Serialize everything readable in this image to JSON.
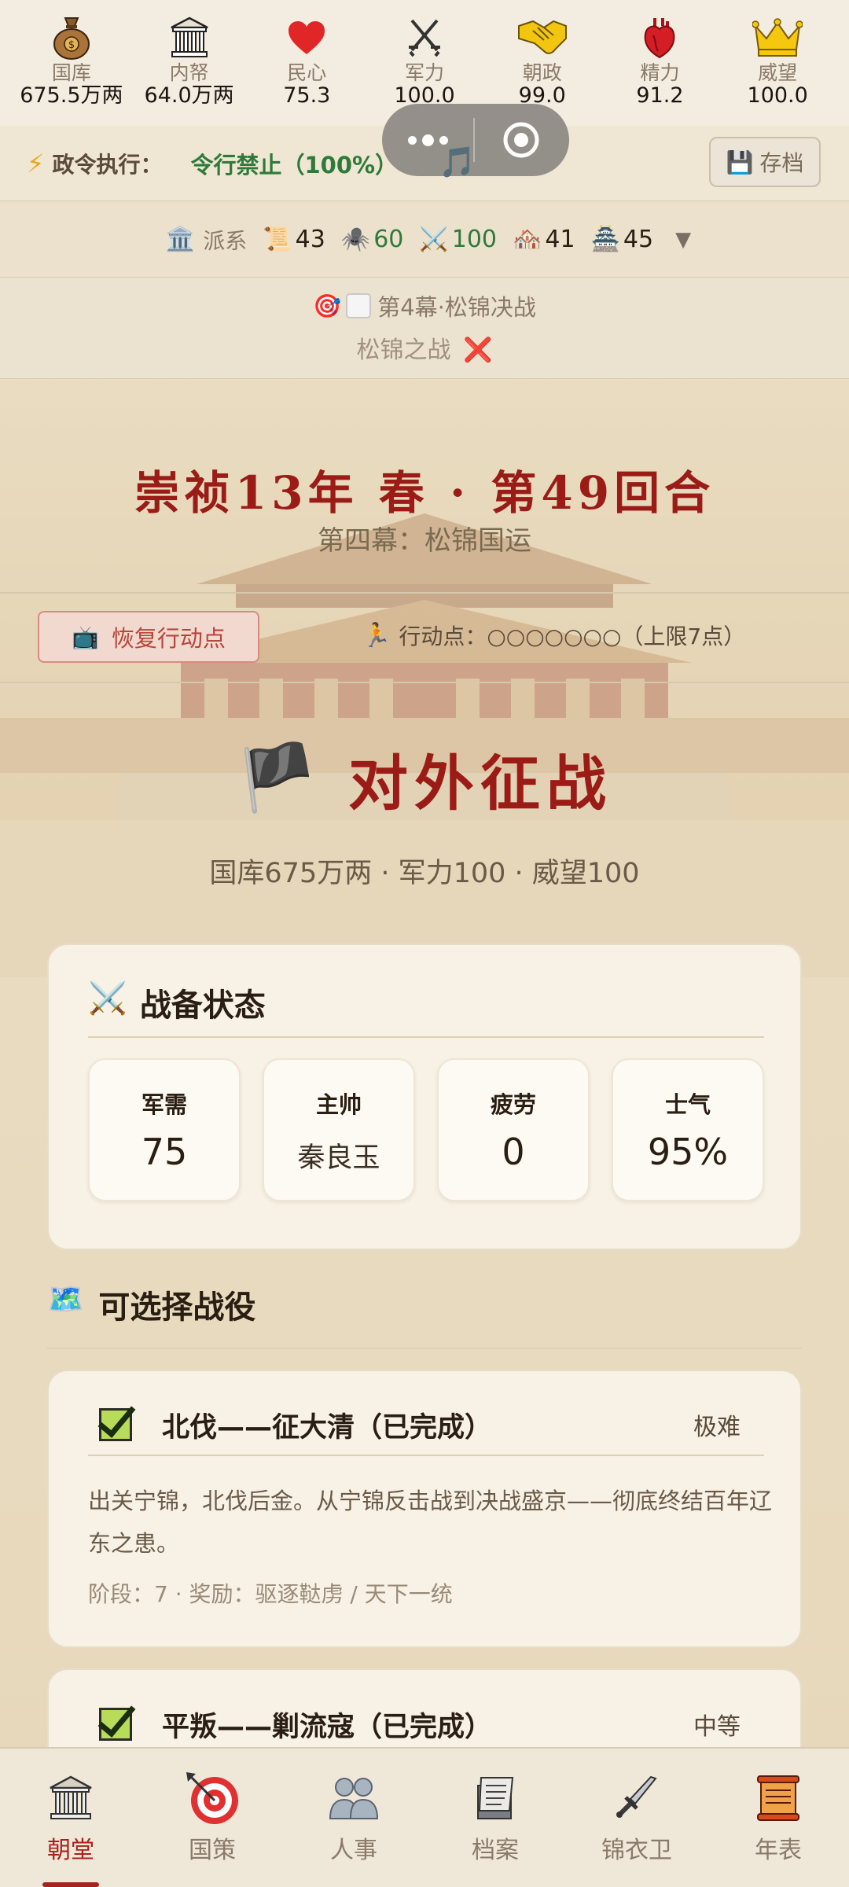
{
  "stats": [
    {
      "icon": "money-bag-icon",
      "label": "国库",
      "value": "675.5万两"
    },
    {
      "icon": "treasury-building-icon",
      "label": "内帑",
      "value": "64.0万两"
    },
    {
      "icon": "heart-icon",
      "label": "民心",
      "value": "75.3"
    },
    {
      "icon": "crossed-swords-icon",
      "label": "军力",
      "value": "100.0"
    },
    {
      "icon": "handshake-icon",
      "label": "朝政",
      "value": "99.0"
    },
    {
      "icon": "anatomical-heart-icon",
      "label": "精力",
      "value": "91.2"
    },
    {
      "icon": "crown-icon",
      "label": "威望",
      "value": "100.0"
    }
  ],
  "decree": {
    "label": "政令执行：",
    "value": "令行禁止（100%）",
    "save_label": "存档"
  },
  "factions": {
    "title": "派系",
    "items": [
      {
        "emoji": "📜",
        "value": "43",
        "color": "#2a1e12"
      },
      {
        "emoji": "🕷️",
        "value": "60",
        "color": "#2f7a3a"
      },
      {
        "emoji": "⚔️",
        "value": "100",
        "color": "#2f7a3a"
      },
      {
        "emoji": "🏘️",
        "value": "41",
        "color": "#2a1e12"
      },
      {
        "emoji": "🏯",
        "value": "45",
        "color": "#2a1e12"
      }
    ]
  },
  "act": {
    "objective": "第4幕·松锦决战",
    "battle": "松锦之战",
    "battle_status": "❌"
  },
  "turn": {
    "title": "崇祯13年 春 · 第49回合",
    "subtitle": "第四幕：松锦国运"
  },
  "actions": {
    "restore_label": "恢复行动点",
    "points_text": "行动点：○○○○○○○（上限7点）"
  },
  "expedition": {
    "title": "对外征战",
    "summary": "国库675万两 · 军力100 · 威望100"
  },
  "readiness": {
    "title": "战备状态",
    "tiles": [
      {
        "label": "军需",
        "value": "75"
      },
      {
        "label": "主帅",
        "value": "秦良玉"
      },
      {
        "label": "疲劳",
        "value": "0"
      },
      {
        "label": "士气",
        "value": "95%"
      }
    ]
  },
  "campaigns": {
    "title": "可选择战役",
    "items": [
      {
        "name": "北伐——征大清（已完成）",
        "difficulty": "极难",
        "desc": "出关宁锦，北伐后金。从宁锦反击战到决战盛京——彻底终结百年辽东之患。",
        "meta": "阶段：7 · 奖励：驱逐鞑虏 / 天下一统"
      },
      {
        "name": "平叛——剿流寇（已完成）",
        "difficulty": "中等",
        "desc": "",
        "meta": ""
      }
    ]
  },
  "nav": [
    {
      "icon": "court-icon",
      "label": "朝堂",
      "active": true
    },
    {
      "icon": "target-icon",
      "label": "国策"
    },
    {
      "icon": "people-icon",
      "label": "人事"
    },
    {
      "icon": "archive-icon",
      "label": "档案"
    },
    {
      "icon": "dagger-icon",
      "label": "锦衣卫"
    },
    {
      "icon": "scroll-icon",
      "label": "年表"
    }
  ],
  "colors": {
    "accent_red": "#9b1c17",
    "green": "#2f7a3a",
    "background": "#ece1c9"
  }
}
